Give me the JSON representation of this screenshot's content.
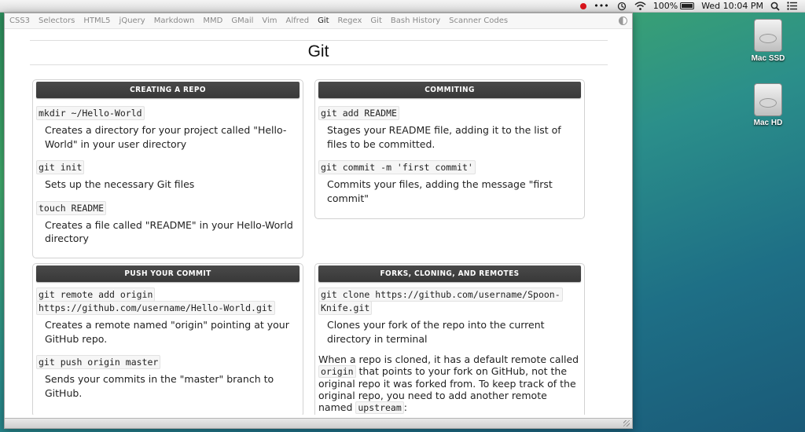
{
  "menubar": {
    "dots": "•••",
    "battery_pct": "100%",
    "clock": "Wed 10:04 PM"
  },
  "desktop": {
    "drives": [
      {
        "label": "Mac SSD"
      },
      {
        "label": "Mac HD"
      }
    ]
  },
  "tabs": [
    {
      "label": "CSS3"
    },
    {
      "label": "Selectors"
    },
    {
      "label": "HTML5"
    },
    {
      "label": "jQuery"
    },
    {
      "label": "Markdown"
    },
    {
      "label": "MMD"
    },
    {
      "label": "GMail"
    },
    {
      "label": "Vim"
    },
    {
      "label": "Alfred"
    },
    {
      "label": "Git",
      "active": true
    },
    {
      "label": "Regex"
    },
    {
      "label": "Git"
    },
    {
      "label": "Bash History"
    },
    {
      "label": "Scanner Codes"
    }
  ],
  "page": {
    "title": "Git"
  },
  "cards": {
    "creating": {
      "title": "CREATING A REPO",
      "items": [
        {
          "cmd": "mkdir ~/Hello-World",
          "desc": "Creates a directory for your project called \"Hello-World\" in your user directory"
        },
        {
          "cmd": "git init",
          "desc": "Sets up the necessary Git files"
        },
        {
          "cmd": "touch README",
          "desc": "Creates a file called \"README\" in your Hello-World directory"
        }
      ]
    },
    "commiting": {
      "title": "COMMITING",
      "items": [
        {
          "cmd": "git add README",
          "desc": "Stages your README file, adding it to the list of files to be committed."
        },
        {
          "cmd": "git commit -m 'first commit'",
          "desc": "Commits your files, adding the message \"first commit\""
        }
      ]
    },
    "push": {
      "title": "PUSH YOUR COMMIT",
      "items": [
        {
          "cmd_line1": "git remote add origin",
          "cmd_line2": "https://github.com/username/Hello-World.git",
          "desc": "Creates a remote named \"origin\" pointing at your GitHub repo."
        },
        {
          "cmd": "git push origin master",
          "desc": "Sends your commits in the \"master\" branch to GitHub."
        }
      ]
    },
    "forks": {
      "title": "FORKS, CLONING, AND REMOTES",
      "items": [
        {
          "cmd_line1": "git clone https://github.com/username/Spoon-",
          "cmd_line2": "Knife.git",
          "desc": "Clones your fork of the repo into the current directory in terminal"
        }
      ],
      "para_part1": "When a repo is cloned, it has a default remote called",
      "para_code1": "origin",
      "para_part2": "that points to your fork on GitHub, not the original repo it was forked from. To keep track of the original repo, you need to add another remote named",
      "para_code2": "upstream",
      "para_part3": ":"
    }
  }
}
